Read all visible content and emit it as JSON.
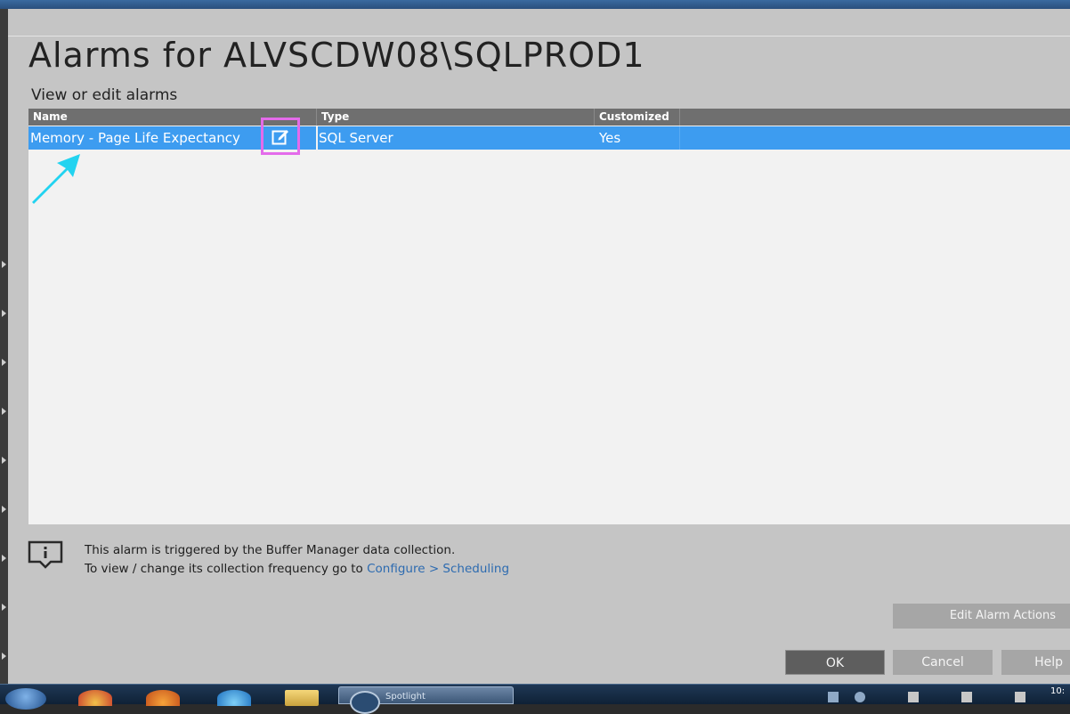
{
  "dialog": {
    "title": "Alarms for ALVSCDW08\\SQLPROD1",
    "subtitle": "View or edit alarms"
  },
  "grid": {
    "columns": [
      "Name",
      "Type",
      "Customized"
    ],
    "rows": [
      {
        "name": "Memory - Page Life Expectancy",
        "type": "SQL Server",
        "customized": "Yes",
        "selected": true
      }
    ]
  },
  "info": {
    "line1": "This alarm is triggered by the Buffer Manager data collection.",
    "line2_prefix": "To view / change its collection frequency go to ",
    "line2_link": "Configure > Scheduling"
  },
  "buttons": {
    "edit_alarm_actions": "Edit Alarm Actions",
    "ok": "OK",
    "cancel": "Cancel",
    "help": "Help"
  },
  "taskbar": {
    "active_window_label": "Spotlight",
    "clock": "10:"
  },
  "colors": {
    "selection": "#3d9cf0",
    "highlight_box": "#e46bea",
    "annotation_arrow": "#22d3f0",
    "link": "#2d6bb0"
  },
  "icons": [
    "edit-icon",
    "info-icon",
    "annotation-arrow-icon",
    "start-orb-icon"
  ]
}
